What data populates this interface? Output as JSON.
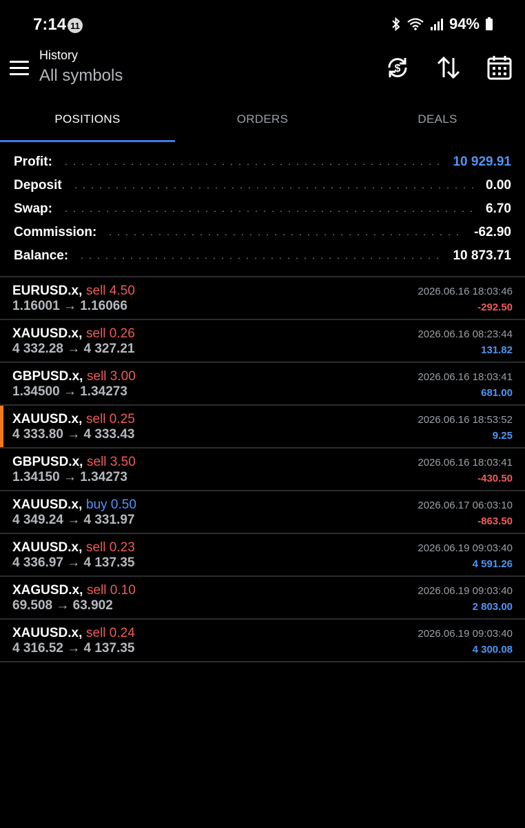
{
  "status_bar": {
    "time": "7:14",
    "notification_count": "11",
    "battery": "94%"
  },
  "header": {
    "title": "History",
    "subtitle": "All symbols"
  },
  "tabs": [
    {
      "label": "POSITIONS",
      "active": true
    },
    {
      "label": "ORDERS",
      "active": false
    },
    {
      "label": "DEALS",
      "active": false
    }
  ],
  "summary": {
    "profit_label": "Profit:",
    "profit": "10 929.91",
    "deposit_label": "Deposit",
    "deposit": "0.00",
    "swap_label": "Swap:",
    "swap": "6.70",
    "commission_label": "Commission:",
    "commission": "-62.90",
    "balance_label": "Balance:",
    "balance": "10 873.71"
  },
  "positions": [
    {
      "symbol": "EURUSD.x,",
      "side": "sell 4.50",
      "direction": "sell",
      "prices": "1.16001 → 1.16066",
      "time": "2026.06.16 18:03:46",
      "profit": "-292.50",
      "sign": "neg"
    },
    {
      "symbol": "XAUUSD.x,",
      "side": "sell 0.26",
      "direction": "sell",
      "prices": "4 332.28 → 4 327.21",
      "time": "2026.06.16 08:23:44",
      "profit": "131.82",
      "sign": "pos"
    },
    {
      "symbol": "GBPUSD.x,",
      "side": "sell 3.00",
      "direction": "sell",
      "prices": "1.34500 → 1.34273",
      "time": "2026.06.16 18:03:41",
      "profit": "681.00",
      "sign": "pos"
    },
    {
      "symbol": "XAUUSD.x,",
      "side": "sell 0.25",
      "direction": "sell",
      "prices": "4 333.80 → 4 333.43",
      "time": "2026.06.16 18:53:52",
      "profit": "9.25",
      "sign": "pos"
    },
    {
      "symbol": "GBPUSD.x,",
      "side": "sell 3.50",
      "direction": "sell",
      "prices": "1.34150 → 1.34273",
      "time": "2026.06.16 18:03:41",
      "profit": "-430.50",
      "sign": "neg"
    },
    {
      "symbol": "XAUUSD.x,",
      "side": "buy 0.50",
      "direction": "buy",
      "prices": "4 349.24 → 4 331.97",
      "time": "2026.06.17 06:03:10",
      "profit": "-863.50",
      "sign": "neg"
    },
    {
      "symbol": "XAUUSD.x,",
      "side": "sell 0.23",
      "direction": "sell",
      "prices": "4 336.97 → 4 137.35",
      "time": "2026.06.19 09:03:40",
      "profit": "4 591.26",
      "sign": "pos"
    },
    {
      "symbol": "XAGUSD.x,",
      "side": "sell 0.10",
      "direction": "sell",
      "prices": "69.508 → 63.902",
      "time": "2026.06.19 09:03:40",
      "profit": "2 803.00",
      "sign": "pos"
    },
    {
      "symbol": "XAUUSD.x,",
      "side": "sell 0.24",
      "direction": "sell",
      "prices": "4 316.52 → 4 137.35",
      "time": "2026.06.19 09:03:40",
      "profit": "4 300.08",
      "sign": "pos"
    }
  ],
  "colors": {
    "accent": "#3d7bea",
    "profit_positive": "#4f95f5",
    "profit_negative": "#f05a5a",
    "highlight": "#f07a1a"
  },
  "icons": [
    "menu-icon",
    "sync-currency-icon",
    "sort-icon",
    "calendar-icon",
    "bluetooth-icon",
    "wifi-icon",
    "signal-icon",
    "battery-icon"
  ]
}
